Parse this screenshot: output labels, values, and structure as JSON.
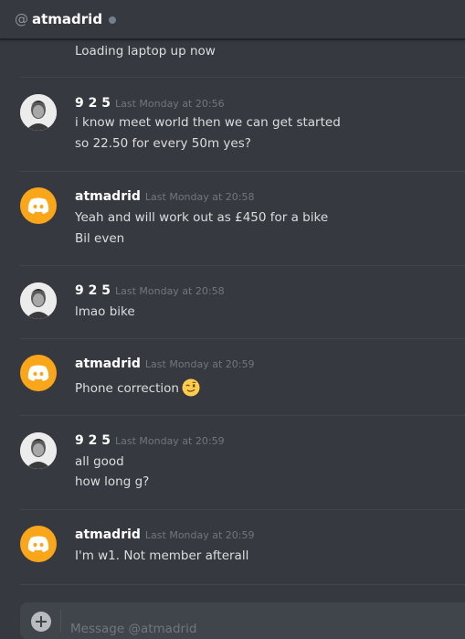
{
  "header": {
    "at_symbol": "@",
    "title": "atmadrid"
  },
  "messages": [
    {
      "id": "m0",
      "lines": [
        "Loading laptop up now"
      ]
    },
    {
      "id": "m1",
      "author": "9 2 5",
      "timestamp": "Last Monday at 20:56",
      "avatar": "photo-avatar",
      "lines": [
        "i know meet world then we can get started",
        "so 22.50  for every 50m yes?"
      ]
    },
    {
      "id": "m2",
      "author": "atmadrid",
      "timestamp": "Last Monday at 20:58",
      "avatar": "discord-logo-avatar",
      "lines": [
        "Yeah and will work out as £450 for a bike",
        "Bil even"
      ]
    },
    {
      "id": "m3",
      "author": "9 2 5",
      "timestamp": "Last Monday at 20:58",
      "avatar": "photo-avatar",
      "lines": [
        "lmao bike"
      ]
    },
    {
      "id": "m4",
      "author": "atmadrid",
      "timestamp": "Last Monday at 20:59",
      "avatar": "discord-logo-avatar",
      "lines": [
        "Phone correction"
      ],
      "emoji": "winking-face-emoji"
    },
    {
      "id": "m5",
      "author": "9 2 5",
      "timestamp": "Last Monday at 20:59",
      "avatar": "photo-avatar",
      "lines": [
        "all good",
        "how long g?"
      ]
    },
    {
      "id": "m6",
      "author": "atmadrid",
      "timestamp": "Last Monday at 20:59",
      "avatar": "discord-logo-avatar",
      "lines": [
        "I'm w1. Not member afterall"
      ]
    }
  ],
  "composer": {
    "placeholder": "Message @atmadrid"
  },
  "colors": {
    "background": "#36393f",
    "discord_avatar": "#faa61a",
    "status_offline": "#747f8d",
    "timestamp": "#72767d",
    "text": "#dcddde"
  }
}
